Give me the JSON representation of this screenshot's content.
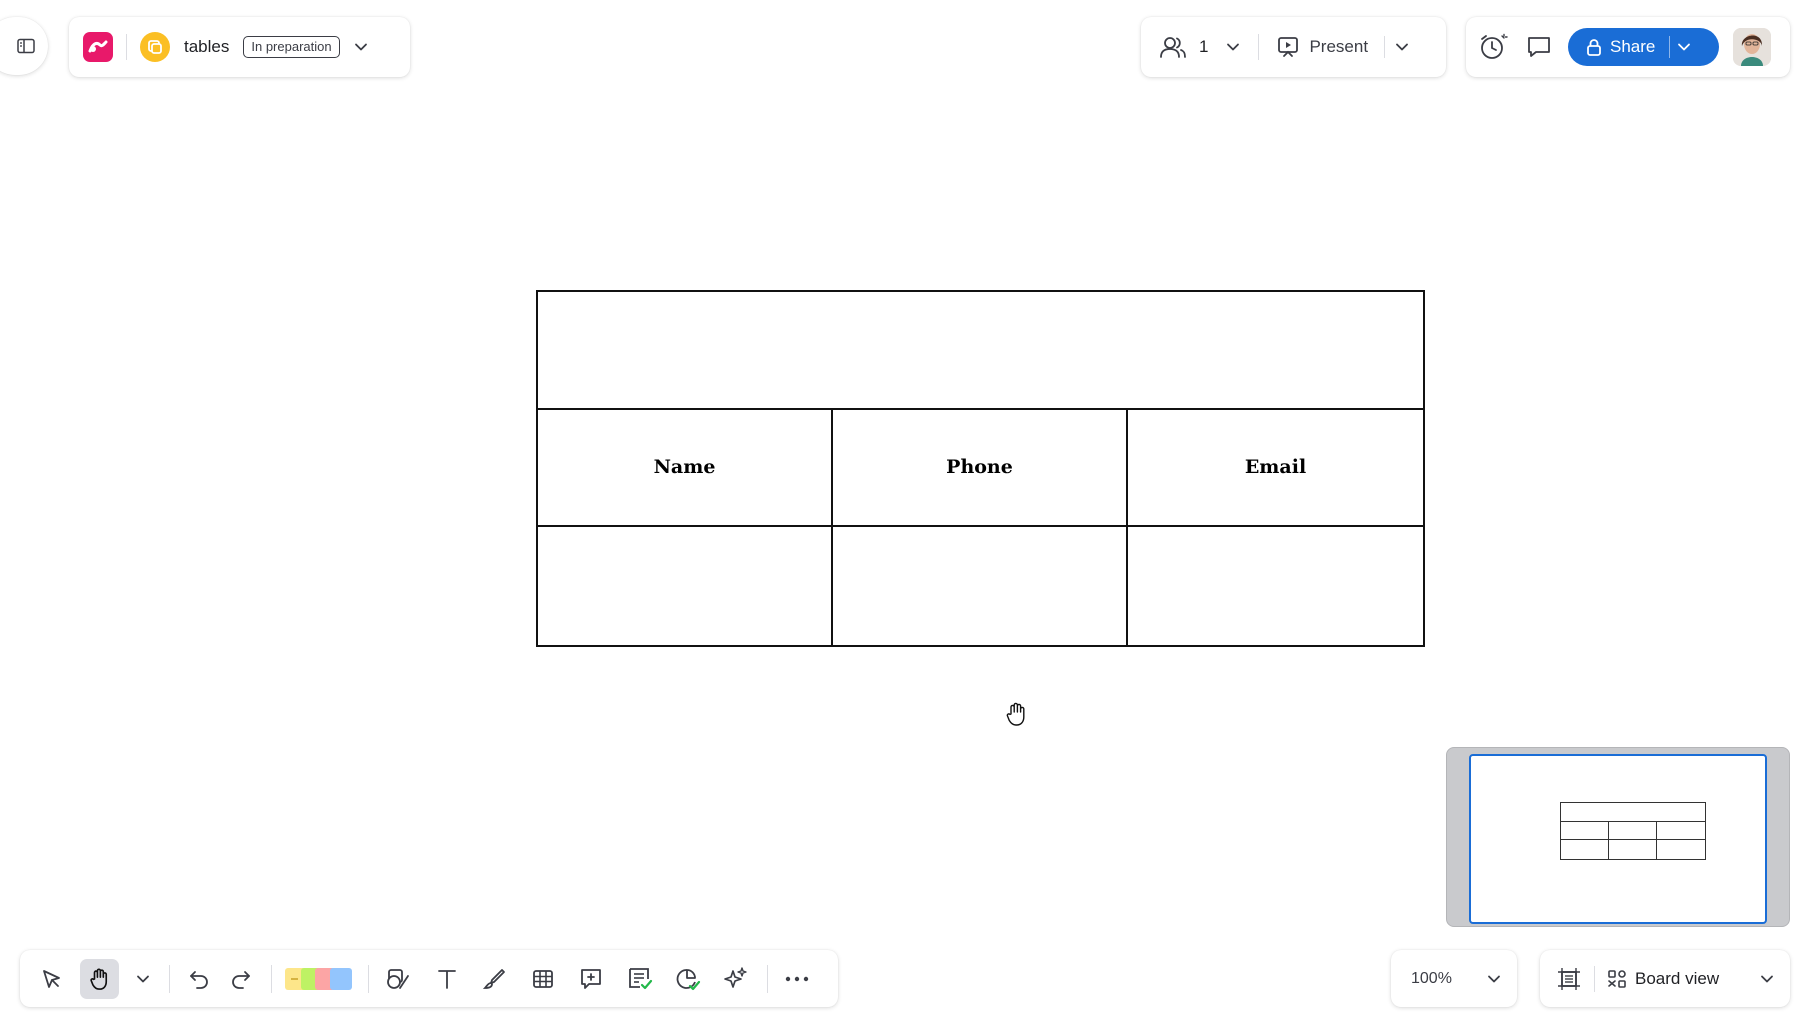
{
  "sidebar_toggle": {
    "icon": "sidebar-panel-icon"
  },
  "board_header": {
    "app_logo": "miro-logo-icon",
    "board_icon": "board-icon",
    "board_name": "tables",
    "status": "In preparation",
    "menu_icon": "chevron-down-icon"
  },
  "collaboration": {
    "users_icon": "users-icon",
    "user_count": "1",
    "present_label": "Present"
  },
  "share_bar": {
    "timer_icon": "timer-icon",
    "comments_icon": "comment-icon",
    "share_label": "Share"
  },
  "table": {
    "title": "",
    "headers": [
      "Name",
      "Phone",
      "Email"
    ],
    "rows": [
      [
        "",
        "",
        ""
      ]
    ]
  },
  "zoom": {
    "value": "100%"
  },
  "view": {
    "label": "Board view"
  },
  "toolbar": {
    "tools": [
      "select-icon",
      "hand-icon",
      "undo-icon",
      "redo-icon",
      "sticky-notes-icon",
      "shapes-icon",
      "text-icon",
      "pen-icon",
      "table-icon",
      "comment-add-icon",
      "card-icon",
      "diagram-icon",
      "ai-sparkle-icon",
      "more-icon"
    ],
    "sticky_colors": [
      "#fde68a",
      "#bef264",
      "#fca5a5",
      "#93c5fd"
    ],
    "active_tool": "hand-icon"
  },
  "colors": {
    "accent": "#1a6dd6",
    "logo": "#e8196a",
    "board_icon": "#fbbf24"
  }
}
